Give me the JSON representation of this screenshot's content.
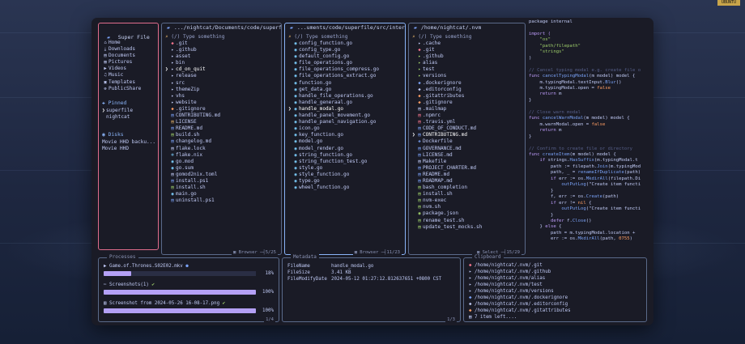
{
  "corner_badge": "UBUNTU",
  "sidebar": {
    "title": "Super File",
    "well_known": [
      {
        "label": "Home",
        "icon": "home-icon",
        "glyph": "⌂",
        "color": "#c0caf5"
      },
      {
        "label": "Downloads",
        "icon": "download-icon",
        "glyph": "⤓",
        "color": "#c0caf5"
      },
      {
        "label": "Documents",
        "icon": "document-icon",
        "glyph": "▤",
        "color": "#c0caf5"
      },
      {
        "label": "Pictures",
        "icon": "picture-icon",
        "glyph": "▨",
        "color": "#c0caf5"
      },
      {
        "label": "Videos",
        "icon": "video-icon",
        "glyph": "▶",
        "color": "#c0caf5"
      },
      {
        "label": "Music",
        "icon": "music-icon",
        "glyph": "♫",
        "color": "#c0caf5"
      },
      {
        "label": "Templates",
        "icon": "template-icon",
        "glyph": "▣",
        "color": "#c0caf5"
      },
      {
        "label": "PublicShare",
        "icon": "share-icon",
        "glyph": "⊕",
        "color": "#c0caf5"
      }
    ],
    "pinned_title": "Pinned",
    "pinned": [
      "superfile",
      "nightcat"
    ],
    "disks_title": "Disks",
    "disks": [
      "Movie HHD backu...",
      "Movie HHD"
    ]
  },
  "panels": [
    {
      "path": ".../nightcat/Documents/code/superfile",
      "search_placeholder": "(/) Type something",
      "footer_mode": "Browser",
      "footer_count": "5/25",
      "cursor_index": 4,
      "items": [
        {
          "name": ".git",
          "glyph": "◆",
          "color": "#f7768e"
        },
        {
          "name": ".github",
          "glyph": "▸",
          "color": "#c0caf5"
        },
        {
          "name": "asset",
          "glyph": "▸",
          "color": "#c0caf5"
        },
        {
          "name": "bin",
          "glyph": "▸",
          "color": "#c0caf5"
        },
        {
          "name": "cd_on_quit",
          "glyph": "▸",
          "color": "#c0caf5"
        },
        {
          "name": "release",
          "glyph": "▸",
          "color": "#c0caf5"
        },
        {
          "name": "src",
          "glyph": "▸",
          "color": "#c0caf5"
        },
        {
          "name": "themeZip",
          "glyph": "▸",
          "color": "#c0caf5"
        },
        {
          "name": "vhs",
          "glyph": "▸",
          "color": "#c0caf5"
        },
        {
          "name": "website",
          "glyph": "▸",
          "color": "#c0caf5"
        },
        {
          "name": ".gitignore",
          "glyph": "◆",
          "color": "#ff9e64"
        },
        {
          "name": "CONTRIBUTING.md",
          "glyph": "▤",
          "color": "#7aa2f7"
        },
        {
          "name": "LICENSE",
          "glyph": "▤",
          "color": "#e0af68"
        },
        {
          "name": "README.md",
          "glyph": "▤",
          "color": "#7aa2f7"
        },
        {
          "name": "build.sh",
          "glyph": "▤",
          "color": "#9ece6a"
        },
        {
          "name": "changelog.md",
          "glyph": "▤",
          "color": "#7aa2f7"
        },
        {
          "name": "flake.lock",
          "glyph": "▤",
          "color": "#c0caf5"
        },
        {
          "name": "flake.nix",
          "glyph": "❄",
          "color": "#7dcfff"
        },
        {
          "name": "go.mod",
          "glyph": "◉",
          "color": "#7dcfff"
        },
        {
          "name": "go.sum",
          "glyph": "◉",
          "color": "#7dcfff"
        },
        {
          "name": "gomod2nix.toml",
          "glyph": "▤",
          "color": "#c0caf5"
        },
        {
          "name": "install.ps1",
          "glyph": "▤",
          "color": "#7aa2f7"
        },
        {
          "name": "install.sh",
          "glyph": "▤",
          "color": "#9ece6a"
        },
        {
          "name": "main.go",
          "glyph": "◉",
          "color": "#7dcfff"
        },
        {
          "name": "uninstall.ps1",
          "glyph": "▤",
          "color": "#7aa2f7"
        }
      ]
    },
    {
      "path": "...uments/code/superfile/src/internal",
      "search_placeholder": "(/) Type something",
      "footer_mode": "Browser",
      "footer_count": "11/23",
      "cursor_index": 10,
      "items": [
        {
          "name": "config_function.go",
          "glyph": "◉",
          "color": "#7dcfff"
        },
        {
          "name": "config_type.go",
          "glyph": "◉",
          "color": "#7dcfff"
        },
        {
          "name": "default_config.go",
          "glyph": "◉",
          "color": "#7dcfff"
        },
        {
          "name": "file_operations.go",
          "glyph": "◉",
          "color": "#7dcfff"
        },
        {
          "name": "file_operations_compress.go",
          "glyph": "◉",
          "color": "#7dcfff"
        },
        {
          "name": "file_operations_extract.go",
          "glyph": "◉",
          "color": "#7dcfff"
        },
        {
          "name": "function.go",
          "glyph": "◉",
          "color": "#7dcfff"
        },
        {
          "name": "get_data.go",
          "glyph": "◉",
          "color": "#7dcfff"
        },
        {
          "name": "handle_file_operations.go",
          "glyph": "◉",
          "color": "#7dcfff"
        },
        {
          "name": "handle_generaal.go",
          "glyph": "◉",
          "color": "#7dcfff"
        },
        {
          "name": "handle_modal.go",
          "glyph": "◉",
          "color": "#7dcfff"
        },
        {
          "name": "handle_panel_movement.go",
          "glyph": "◉",
          "color": "#7dcfff"
        },
        {
          "name": "handle_panel_navigation.go",
          "glyph": "◉",
          "color": "#7dcfff"
        },
        {
          "name": "icon.go",
          "glyph": "◉",
          "color": "#7dcfff"
        },
        {
          "name": "key_function.go",
          "glyph": "◉",
          "color": "#7dcfff"
        },
        {
          "name": "model.go",
          "glyph": "◉",
          "color": "#7dcfff"
        },
        {
          "name": "model_render.go",
          "glyph": "◉",
          "color": "#7dcfff"
        },
        {
          "name": "string_function.go",
          "glyph": "◉",
          "color": "#7dcfff"
        },
        {
          "name": "string_function_test.go",
          "glyph": "◉",
          "color": "#7dcfff"
        },
        {
          "name": "style.go",
          "glyph": "◉",
          "color": "#7dcfff"
        },
        {
          "name": "style_function.go",
          "glyph": "◉",
          "color": "#7dcfff"
        },
        {
          "name": "type.go",
          "glyph": "◉",
          "color": "#7dcfff"
        },
        {
          "name": "wheel_function.go",
          "glyph": "◉",
          "color": "#7dcfff"
        }
      ]
    },
    {
      "path": "/home/nightcat/.nvm",
      "search_placeholder": "(/) Type something",
      "footer_mode": "Select",
      "footer_count": "15/29",
      "cursor_index": 14,
      "items": [
        {
          "name": ".cache",
          "glyph": "▸",
          "color": "#c0caf5"
        },
        {
          "name": ".git",
          "glyph": "◆",
          "color": "#f7768e"
        },
        {
          "name": ".github",
          "glyph": "▸",
          "color": "#9ece6a"
        },
        {
          "name": "alias",
          "glyph": "▸",
          "color": "#9ece6a"
        },
        {
          "name": "test",
          "glyph": "▸",
          "color": "#9ece6a"
        },
        {
          "name": "versions",
          "glyph": "▸",
          "color": "#9ece6a"
        },
        {
          "name": ".dockerignore",
          "glyph": "◆",
          "color": "#7aa2f7"
        },
        {
          "name": ".editorconfig",
          "glyph": "◆",
          "color": "#c0caf5"
        },
        {
          "name": ".gitattributes",
          "glyph": "◆",
          "color": "#ff9e64"
        },
        {
          "name": ".gitignore",
          "glyph": "◆",
          "color": "#ff9e64"
        },
        {
          "name": ".mailmap",
          "glyph": "▤",
          "color": "#c0caf5"
        },
        {
          "name": ".npmrc",
          "glyph": "▤",
          "color": "#f7768e"
        },
        {
          "name": ".travis.yml",
          "glyph": "▤",
          "color": "#f7768e"
        },
        {
          "name": "CODE_OF_CONDUCT.md",
          "glyph": "▤",
          "color": "#7aa2f7"
        },
        {
          "name": "CONTRIBUTING.md",
          "glyph": "▤",
          "color": "#7aa2f7"
        },
        {
          "name": "Dockerfile",
          "glyph": "◈",
          "color": "#7aa2f7"
        },
        {
          "name": "GOVERNANCE.md",
          "glyph": "▤",
          "color": "#7aa2f7"
        },
        {
          "name": "LICENSE.md",
          "glyph": "▤",
          "color": "#7aa2f7"
        },
        {
          "name": "Makefile",
          "glyph": "▤",
          "color": "#c0caf5"
        },
        {
          "name": "PROJECT_CHARTER.md",
          "glyph": "▤",
          "color": "#7aa2f7"
        },
        {
          "name": "README.md",
          "glyph": "▤",
          "color": "#7aa2f7"
        },
        {
          "name": "ROADMAP.md",
          "glyph": "▤",
          "color": "#7aa2f7"
        },
        {
          "name": "bash_completion",
          "glyph": "▤",
          "color": "#9ece6a"
        },
        {
          "name": "install.sh",
          "glyph": "▤",
          "color": "#9ece6a"
        },
        {
          "name": "nvm-exec",
          "glyph": "▤",
          "color": "#9ece6a"
        },
        {
          "name": "nvm.sh",
          "glyph": "▤",
          "color": "#9ece6a"
        },
        {
          "name": "package.json",
          "glyph": "◉",
          "color": "#9ece6a"
        },
        {
          "name": "rename_test.sh",
          "glyph": "▤",
          "color": "#9ece6a"
        },
        {
          "name": "update_test_mocks.sh",
          "glyph": "▤",
          "color": "#9ece6a"
        }
      ]
    }
  ],
  "code_lines": [
    [
      [
        "package internal",
        ""
      ]
    ],
    [
      [
        "",
        ""
      ]
    ],
    [
      [
        "import (",
        "kw"
      ]
    ],
    [
      [
        "    ",
        ""
      ],
      [
        "\"os\"",
        "str"
      ]
    ],
    [
      [
        "    ",
        ""
      ],
      [
        "\"path/filepath\"",
        "str"
      ]
    ],
    [
      [
        "    ",
        ""
      ],
      [
        "\"strings\"",
        "str"
      ]
    ],
    [
      [
        ")",
        ""
      ]
    ],
    [
      [
        "",
        ""
      ]
    ],
    [
      [
        "// Cancel typing modal e.g. create file o",
        "cm"
      ]
    ],
    [
      [
        "func ",
        "kw"
      ],
      [
        "cancelTypingModal",
        "fn"
      ],
      [
        "(m model) model {",
        ""
      ]
    ],
    [
      [
        "    m.typingModal.textInput.",
        ""
      ],
      [
        "Blur",
        "fn"
      ],
      [
        "()",
        ""
      ]
    ],
    [
      [
        "    m.typingModal.open = ",
        ""
      ],
      [
        "false",
        "or"
      ]
    ],
    [
      [
        "    ",
        ""
      ],
      [
        "return",
        "kw"
      ],
      [
        " m",
        ""
      ]
    ],
    [
      [
        "}",
        ""
      ]
    ],
    [
      [
        "",
        ""
      ]
    ],
    [
      [
        "// Close warn modal",
        "cm"
      ]
    ],
    [
      [
        "func ",
        "kw"
      ],
      [
        "cancelWarnModal",
        "fn"
      ],
      [
        "(m model) model {",
        ""
      ]
    ],
    [
      [
        "    m.warnModal.open = ",
        ""
      ],
      [
        "false",
        "or"
      ]
    ],
    [
      [
        "    ",
        ""
      ],
      [
        "return",
        "kw"
      ],
      [
        " m",
        ""
      ]
    ],
    [
      [
        "}",
        ""
      ]
    ],
    [
      [
        "",
        ""
      ]
    ],
    [
      [
        "// Confirm to create file or directory",
        "cm"
      ]
    ],
    [
      [
        "func ",
        "kw"
      ],
      [
        "createItem",
        "fn"
      ],
      [
        "(m model) model {",
        ""
      ]
    ],
    [
      [
        "    ",
        ""
      ],
      [
        "if",
        "kw"
      ],
      [
        " strings.",
        ""
      ],
      [
        "HasSuffix",
        "fn"
      ],
      [
        "(m.typingModal.t",
        ""
      ]
    ],
    [
      [
        "        path := filepath.",
        ""
      ],
      [
        "Join",
        "fn"
      ],
      [
        "(m.typingMod",
        ""
      ]
    ],
    [
      [
        "        path, _ = ",
        ""
      ],
      [
        "renameIfDuplicate",
        "fn"
      ],
      [
        "(path)",
        ""
      ]
    ],
    [
      [
        "        ",
        ""
      ],
      [
        "if",
        "kw"
      ],
      [
        " err := os.",
        ""
      ],
      [
        "MkdirAll",
        "fn"
      ],
      [
        "(filepath.Di",
        ""
      ]
    ],
    [
      [
        "            ",
        ""
      ],
      [
        "outPutLog",
        "fn"
      ],
      [
        "(\"Create item functi",
        ""
      ]
    ],
    [
      [
        "        }",
        ""
      ]
    ],
    [
      [
        "        f, err := os.",
        ""
      ],
      [
        "Create",
        "fn"
      ],
      [
        "(path)",
        ""
      ]
    ],
    [
      [
        "        ",
        ""
      ],
      [
        "if",
        "kw"
      ],
      [
        " err != ",
        ""
      ],
      [
        "nil",
        "or"
      ],
      [
        " {",
        ""
      ]
    ],
    [
      [
        "            ",
        ""
      ],
      [
        "outPutLog",
        "fn"
      ],
      [
        "(\"Create item functi",
        ""
      ]
    ],
    [
      [
        "        }",
        ""
      ]
    ],
    [
      [
        "        ",
        ""
      ],
      [
        "defer",
        "kw"
      ],
      [
        " f.",
        ""
      ],
      [
        "Close",
        "fn"
      ],
      [
        "()",
        ""
      ]
    ],
    [
      [
        "    } ",
        ""
      ],
      [
        "else",
        "kw"
      ],
      [
        " {",
        ""
      ]
    ],
    [
      [
        "        path = m.typingModal.location +",
        ""
      ]
    ],
    [
      [
        "        err := os.",
        ""
      ],
      [
        "MkdirAll",
        "fn"
      ],
      [
        "(path, ",
        ""
      ],
      [
        "0755",
        "or"
      ],
      [
        ")",
        ""
      ]
    ]
  ],
  "processes": {
    "title": "Processes",
    "footer": "1/4",
    "items": [
      {
        "name": "Game.of.Thrones.S02E02.mkv",
        "status_glyph": "●",
        "status_color": "#7aa2f7",
        "percent": "18%",
        "progress": 0.18,
        "icon": "video-icon",
        "glyph": "▶"
      },
      {
        "name": "Screenshots(1)",
        "status_glyph": "✔",
        "status_color": "#9ece6a",
        "percent": "100%",
        "progress": 1.0,
        "icon": "scissors-icon",
        "glyph": "✂"
      },
      {
        "name": "Screenshot from 2024-05-26 16-08-17.png",
        "status_glyph": "✔",
        "status_color": "#9ece6a",
        "percent": "100%",
        "progress": 1.0,
        "icon": "picture-icon",
        "glyph": "▨"
      }
    ]
  },
  "metadata": {
    "title": "Metadata",
    "footer": "1/3",
    "rows": [
      {
        "key": "FileName",
        "value": "handle_modal.go"
      },
      {
        "key": "FileSize",
        "value": "3.41 KB"
      },
      {
        "key": "FileModifyDate",
        "value": "2024-05-12 01:27:12.812637651 +0800 CST"
      }
    ]
  },
  "clipboard": {
    "title": "Clipboard",
    "items": [
      {
        "path": "/home/nightcat/.nvm/.git",
        "glyph": "◆",
        "color": "#f7768e"
      },
      {
        "path": "/home/nightcat/.nvm/.github",
        "glyph": "▸",
        "color": "#c0caf5"
      },
      {
        "path": "/home/nightcat/.nvm/alias",
        "glyph": "▸",
        "color": "#c0caf5"
      },
      {
        "path": "/home/nightcat/.nvm/test",
        "glyph": "▸",
        "color": "#c0caf5"
      },
      {
        "path": "/home/nightcat/.nvm/versions",
        "glyph": "▸",
        "color": "#c0caf5"
      },
      {
        "path": "/home/nightcat/.nvm/.dockerignore",
        "glyph": "◆",
        "color": "#7aa2f7"
      },
      {
        "path": "/home/nightcat/.nvm/.editorconfig",
        "glyph": "◆",
        "color": "#c0caf5"
      },
      {
        "path": "/home/nightcat/.nvm/.gitattributes",
        "glyph": "◆",
        "color": "#ff9e64"
      }
    ],
    "more": "7 item left...."
  }
}
